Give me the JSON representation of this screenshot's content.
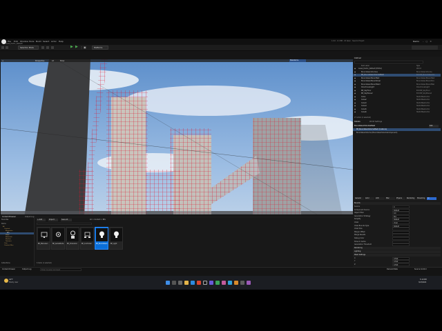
{
  "app": {
    "level_tab": "Level_Demo_Default",
    "menus": [
      "File",
      "Edit",
      "Window",
      "Tools",
      "Build",
      "Select",
      "Actor",
      "Help"
    ],
    "top_right_status": "1.0.0 · 4.1 MB · 22 Open · Save to Project",
    "project_name": "Demo"
  },
  "toolbar": {
    "selection_mode": "Selection Mode",
    "platforms": "Platforms"
  },
  "viewport": {
    "mode": "Perspective",
    "lit": "Lit",
    "show": "Show",
    "right_label": "Standard ▾"
  },
  "content_browser": {
    "tab_label": "Content Browser",
    "output_log": "Output Log",
    "add_label": "+ Add",
    "import_label": "Import",
    "save_all": "Save All",
    "path": "All > Content > BPs",
    "search_placeholder": "Search BPs",
    "favorites": "Favorites",
    "project": "Demo",
    "folders": [
      "All",
      "Content",
      "Blueprints",
      "BPs",
      "Maps",
      "Materials",
      "Meshes",
      "Textures",
      "Core",
      "Content Files"
    ],
    "collections": "Collections",
    "items_count": "6 items (1 selected)",
    "assets": [
      {
        "label": "BP_MenuGen",
        "selected": false,
        "icon": "monitor-icon"
      },
      {
        "label": "BP_GameMode",
        "selected": false,
        "icon": "gear-icon"
      },
      {
        "label": "BP_Character",
        "selected": false,
        "icon": "character-icon"
      },
      {
        "label": "BP_Controller",
        "selected": false,
        "icon": "controller-icon"
      },
      {
        "label": "BP_BoundsGen",
        "selected": true,
        "icon": "bulb-icon"
      },
      {
        "label": "BP_Light",
        "selected": false,
        "icon": "bulb-icon"
      }
    ]
  },
  "outliner": {
    "tab_label": "Outliner",
    "search_placeholder": "Search...",
    "col_label": "Item Label",
    "col_type": "Type",
    "footer": "27 actors (1 selected)",
    "rows": [
      {
        "name": "Level_Demo_Default (Editor)",
        "type": "World"
      },
      {
        "name": "BoundsGenVolumes",
        "type": "BoundsGenVolume"
      },
      {
        "name": "BP_BoundsGenVolumeMesh",
        "type": "Edit BP_BoundsGenVo"
      },
      {
        "name": "BoundsGenPlacedTest",
        "type": "BoundsGenPlacedTest"
      },
      {
        "name": "BoundsGenPlacedVoxel",
        "type": "BoundsGenPlacedVox"
      },
      {
        "name": "BoundsGenPlacedWeld",
        "type": "BoundsGenPlacedWel"
      },
      {
        "name": "DirectionalLight",
        "type": "DirectionalLight"
      },
      {
        "name": "BP_SkyFloor",
        "type": "Edit BP_SkyFloor"
      },
      {
        "name": "BP_SkyPlane2",
        "type": "Edit BP_SkyPlane2"
      },
      {
        "name": "Cube",
        "type": "StaticMeshActor"
      },
      {
        "name": "Cube2",
        "type": "StaticMeshActor"
      },
      {
        "name": "Cube3",
        "type": "StaticMeshActor"
      },
      {
        "name": "Cube4",
        "type": "StaticMeshActor"
      },
      {
        "name": "Cube5",
        "type": "StaticMeshActor"
      },
      {
        "name": "Cube6",
        "type": "StaticMeshActor"
      }
    ]
  },
  "details": {
    "tab_label": "Details",
    "world_settings": "World Settings",
    "actor_name": "BoundsGenVolumeMesh",
    "component_name": "BP_BoundsGenVolumeMesh (Instance)",
    "sub_component": "BoundsGenVolume (BoundsGenVolumeComponent)",
    "edit_label": "Edit",
    "filter_tabs": [
      "General",
      "Actor",
      "LOD",
      "Misc",
      "Physics",
      "Rendering",
      "Streaming",
      "All"
    ],
    "sections": [
      {
        "title": "Bounds",
        "props": [
          {
            "label": "Source",
            "value": "0"
          },
          {
            "label": "Component Source",
            "value": "Default"
          },
          {
            "label": "Object Filter",
            "value": "0.0"
          },
          {
            "label": "Generation Strategy",
            "value": "Box"
          },
          {
            "label": "Simplify",
            "value": "Default"
          },
          {
            "label": "Voxel",
            "value": "Voxel"
          },
          {
            "label": "Voxel Bounds Type",
            "value": "Default"
          },
          {
            "label": "Voxel Size",
            "value": ""
          },
          {
            "label": "Margin Offset",
            "value": ""
          },
          {
            "label": "Merge Results",
            "value": ""
          },
          {
            "label": "Debug Color",
            "value": ""
          },
          {
            "label": "Show In Game",
            "value": ""
          },
          {
            "label": "Generation Threshold",
            "value": ""
          }
        ]
      },
      {
        "title": "Rendering",
        "props": []
      },
      {
        "title": "Lighting",
        "props": []
      },
      {
        "title": "Mesh Settings",
        "props": [
          {
            "label": "X",
            "value": "0.500"
          },
          {
            "label": "Y",
            "value": "0.500"
          },
          {
            "label": "Z",
            "value": "0.500"
          },
          {
            "label": "Collision",
            "value": ""
          },
          {
            "label": "Distribution",
            "value": ""
          },
          {
            "label": "Mesh Scale",
            "value": "1.0"
          },
          {
            "label": "Volume Shape Override",
            "value": ""
          },
          {
            "label": "Generate Bounds Only",
            "value": "1.00"
          }
        ]
      },
      {
        "title": "Actor",
        "props": []
      },
      {
        "title": "HLOD",
        "props": []
      },
      {
        "title": "Advanced",
        "props": []
      }
    ]
  },
  "statusbar": {
    "content_drawer": "Content Drawer",
    "output_log": "Output Log",
    "cmd_placeholder": "Enter Console Command",
    "derived_data": "Derived Data",
    "source_control": "Source Control"
  },
  "taskbar": {
    "weather_temp": "44°F",
    "weather_desc": "Mostly clear",
    "time": "5:10 PM",
    "date": "3/23/2024"
  }
}
